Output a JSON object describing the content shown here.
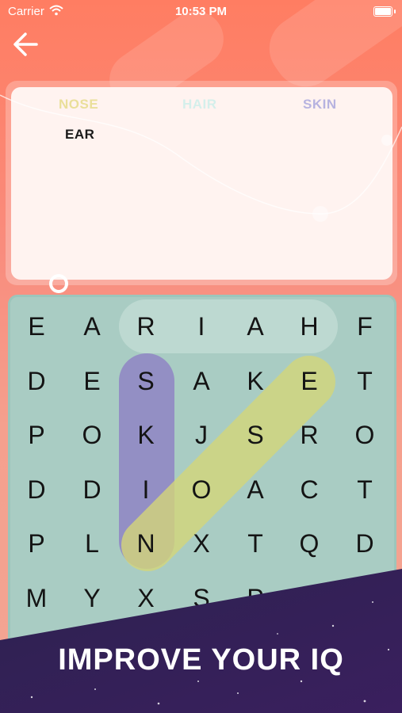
{
  "status_bar": {
    "carrier": "Carrier",
    "time": "10:53 PM"
  },
  "words": {
    "found": [
      {
        "label": "NOSE",
        "color": "#eadf9a"
      },
      {
        "label": "HAIR",
        "color": "#d4efeb"
      },
      {
        "label": "SKIN",
        "color": "#b7b3e0"
      }
    ],
    "remaining": [
      {
        "label": "EAR"
      }
    ]
  },
  "grid": {
    "rows": [
      [
        "E",
        "A",
        "R",
        "I",
        "A",
        "H",
        "F"
      ],
      [
        "D",
        "E",
        "S",
        "A",
        "K",
        "E",
        "T"
      ],
      [
        "P",
        "O",
        "K",
        "J",
        "S",
        "R",
        "O"
      ],
      [
        "D",
        "D",
        "I",
        "O",
        "A",
        "C",
        "T"
      ],
      [
        "P",
        "L",
        "N",
        "X",
        "T",
        "Q",
        "D"
      ],
      [
        "M",
        "Y",
        "X",
        "S",
        "P",
        "",
        ""
      ]
    ]
  },
  "highlight_colors": {
    "hair": "#c4ddd5",
    "skin": "#8f84c4",
    "nose": "#d4d67a"
  },
  "banner": {
    "text": "IMPROVE YOUR IQ"
  }
}
